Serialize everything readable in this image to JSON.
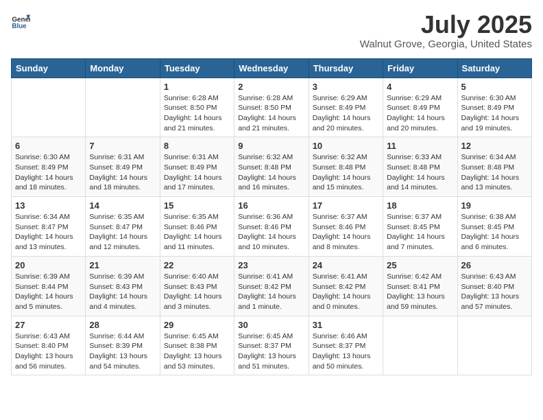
{
  "header": {
    "logo_general": "General",
    "logo_blue": "Blue",
    "month_title": "July 2025",
    "location": "Walnut Grove, Georgia, United States"
  },
  "weekdays": [
    "Sunday",
    "Monday",
    "Tuesday",
    "Wednesday",
    "Thursday",
    "Friday",
    "Saturday"
  ],
  "weeks": [
    [
      {
        "day": "",
        "sunrise": "",
        "sunset": "",
        "daylight": ""
      },
      {
        "day": "",
        "sunrise": "",
        "sunset": "",
        "daylight": ""
      },
      {
        "day": "1",
        "sunrise": "Sunrise: 6:28 AM",
        "sunset": "Sunset: 8:50 PM",
        "daylight": "Daylight: 14 hours and 21 minutes."
      },
      {
        "day": "2",
        "sunrise": "Sunrise: 6:28 AM",
        "sunset": "Sunset: 8:50 PM",
        "daylight": "Daylight: 14 hours and 21 minutes."
      },
      {
        "day": "3",
        "sunrise": "Sunrise: 6:29 AM",
        "sunset": "Sunset: 8:49 PM",
        "daylight": "Daylight: 14 hours and 20 minutes."
      },
      {
        "day": "4",
        "sunrise": "Sunrise: 6:29 AM",
        "sunset": "Sunset: 8:49 PM",
        "daylight": "Daylight: 14 hours and 20 minutes."
      },
      {
        "day": "5",
        "sunrise": "Sunrise: 6:30 AM",
        "sunset": "Sunset: 8:49 PM",
        "daylight": "Daylight: 14 hours and 19 minutes."
      }
    ],
    [
      {
        "day": "6",
        "sunrise": "Sunrise: 6:30 AM",
        "sunset": "Sunset: 8:49 PM",
        "daylight": "Daylight: 14 hours and 18 minutes."
      },
      {
        "day": "7",
        "sunrise": "Sunrise: 6:31 AM",
        "sunset": "Sunset: 8:49 PM",
        "daylight": "Daylight: 14 hours and 18 minutes."
      },
      {
        "day": "8",
        "sunrise": "Sunrise: 6:31 AM",
        "sunset": "Sunset: 8:49 PM",
        "daylight": "Daylight: 14 hours and 17 minutes."
      },
      {
        "day": "9",
        "sunrise": "Sunrise: 6:32 AM",
        "sunset": "Sunset: 8:48 PM",
        "daylight": "Daylight: 14 hours and 16 minutes."
      },
      {
        "day": "10",
        "sunrise": "Sunrise: 6:32 AM",
        "sunset": "Sunset: 8:48 PM",
        "daylight": "Daylight: 14 hours and 15 minutes."
      },
      {
        "day": "11",
        "sunrise": "Sunrise: 6:33 AM",
        "sunset": "Sunset: 8:48 PM",
        "daylight": "Daylight: 14 hours and 14 minutes."
      },
      {
        "day": "12",
        "sunrise": "Sunrise: 6:34 AM",
        "sunset": "Sunset: 8:48 PM",
        "daylight": "Daylight: 14 hours and 13 minutes."
      }
    ],
    [
      {
        "day": "13",
        "sunrise": "Sunrise: 6:34 AM",
        "sunset": "Sunset: 8:47 PM",
        "daylight": "Daylight: 14 hours and 13 minutes."
      },
      {
        "day": "14",
        "sunrise": "Sunrise: 6:35 AM",
        "sunset": "Sunset: 8:47 PM",
        "daylight": "Daylight: 14 hours and 12 minutes."
      },
      {
        "day": "15",
        "sunrise": "Sunrise: 6:35 AM",
        "sunset": "Sunset: 8:46 PM",
        "daylight": "Daylight: 14 hours and 11 minutes."
      },
      {
        "day": "16",
        "sunrise": "Sunrise: 6:36 AM",
        "sunset": "Sunset: 8:46 PM",
        "daylight": "Daylight: 14 hours and 10 minutes."
      },
      {
        "day": "17",
        "sunrise": "Sunrise: 6:37 AM",
        "sunset": "Sunset: 8:46 PM",
        "daylight": "Daylight: 14 hours and 8 minutes."
      },
      {
        "day": "18",
        "sunrise": "Sunrise: 6:37 AM",
        "sunset": "Sunset: 8:45 PM",
        "daylight": "Daylight: 14 hours and 7 minutes."
      },
      {
        "day": "19",
        "sunrise": "Sunrise: 6:38 AM",
        "sunset": "Sunset: 8:45 PM",
        "daylight": "Daylight: 14 hours and 6 minutes."
      }
    ],
    [
      {
        "day": "20",
        "sunrise": "Sunrise: 6:39 AM",
        "sunset": "Sunset: 8:44 PM",
        "daylight": "Daylight: 14 hours and 5 minutes."
      },
      {
        "day": "21",
        "sunrise": "Sunrise: 6:39 AM",
        "sunset": "Sunset: 8:43 PM",
        "daylight": "Daylight: 14 hours and 4 minutes."
      },
      {
        "day": "22",
        "sunrise": "Sunrise: 6:40 AM",
        "sunset": "Sunset: 8:43 PM",
        "daylight": "Daylight: 14 hours and 3 minutes."
      },
      {
        "day": "23",
        "sunrise": "Sunrise: 6:41 AM",
        "sunset": "Sunset: 8:42 PM",
        "daylight": "Daylight: 14 hours and 1 minute."
      },
      {
        "day": "24",
        "sunrise": "Sunrise: 6:41 AM",
        "sunset": "Sunset: 8:42 PM",
        "daylight": "Daylight: 14 hours and 0 minutes."
      },
      {
        "day": "25",
        "sunrise": "Sunrise: 6:42 AM",
        "sunset": "Sunset: 8:41 PM",
        "daylight": "Daylight: 13 hours and 59 minutes."
      },
      {
        "day": "26",
        "sunrise": "Sunrise: 6:43 AM",
        "sunset": "Sunset: 8:40 PM",
        "daylight": "Daylight: 13 hours and 57 minutes."
      }
    ],
    [
      {
        "day": "27",
        "sunrise": "Sunrise: 6:43 AM",
        "sunset": "Sunset: 8:40 PM",
        "daylight": "Daylight: 13 hours and 56 minutes."
      },
      {
        "day": "28",
        "sunrise": "Sunrise: 6:44 AM",
        "sunset": "Sunset: 8:39 PM",
        "daylight": "Daylight: 13 hours and 54 minutes."
      },
      {
        "day": "29",
        "sunrise": "Sunrise: 6:45 AM",
        "sunset": "Sunset: 8:38 PM",
        "daylight": "Daylight: 13 hours and 53 minutes."
      },
      {
        "day": "30",
        "sunrise": "Sunrise: 6:45 AM",
        "sunset": "Sunset: 8:37 PM",
        "daylight": "Daylight: 13 hours and 51 minutes."
      },
      {
        "day": "31",
        "sunrise": "Sunrise: 6:46 AM",
        "sunset": "Sunset: 8:37 PM",
        "daylight": "Daylight: 13 hours and 50 minutes."
      },
      {
        "day": "",
        "sunrise": "",
        "sunset": "",
        "daylight": ""
      },
      {
        "day": "",
        "sunrise": "",
        "sunset": "",
        "daylight": ""
      }
    ]
  ]
}
